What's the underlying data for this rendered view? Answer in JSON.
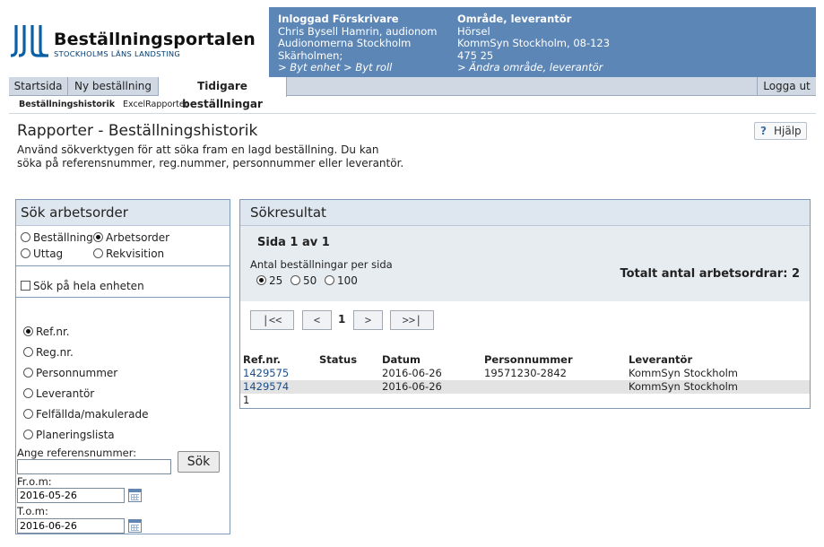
{
  "brand": {
    "title": "Beställningsportalen",
    "subtitle": "STOCKHOLMS LÄNS LANDSTING",
    "color": "#0b5fa5"
  },
  "userbox": {
    "col1": {
      "heading": "Inloggad Förskrivare",
      "lines": [
        "Chris Bysell Hamrin, audionom",
        "Audionomerna Stockholm",
        "Skärholmen;"
      ],
      "link1": "> Byt enhet",
      "link2": "> Byt roll"
    },
    "col2": {
      "heading": "Område, leverantör",
      "lines": [
        "Hörsel",
        "KommSyn Stockholm, 08-123",
        "475 25"
      ],
      "link": "> Ändra område, leverantör"
    },
    "color": "#5b86b6"
  },
  "tabs": [
    {
      "label": "Startsida",
      "active": false
    },
    {
      "label": "Ny beställning",
      "active": false
    },
    {
      "label": "Tidigare beställningar",
      "active": true
    }
  ],
  "logout": "Logga ut",
  "subnav": {
    "items": [
      {
        "label": "Beställningshistorik",
        "active": true
      },
      {
        "label": "ExcelRapporter",
        "active": false
      }
    ]
  },
  "page": {
    "title": "Rapporter - Beställningshistorik",
    "intro_line1": "Använd sökverktygen för att söka fram en lagd beställning. Du kan",
    "intro_line2": "söka på referensnummer, reg.nummer, personnummer eller leverantör.",
    "help_icon": "question-icon",
    "help": "Hjälp"
  },
  "search": {
    "title": "Sök arbetsorder",
    "types": [
      {
        "label": "Beställning",
        "checked": false
      },
      {
        "label": "Arbetsorder",
        "checked": true
      },
      {
        "label": "Uttag",
        "checked": false
      },
      {
        "label": "Rekvisition",
        "checked": false
      }
    ],
    "whole_unit": {
      "label": "Sök på hela enheten",
      "checked": false
    },
    "criteria": [
      {
        "label": "Ref.nr.",
        "checked": true
      },
      {
        "label": "Reg.nr.",
        "checked": false
      },
      {
        "label": "Personnummer",
        "checked": false
      },
      {
        "label": "Leverantör",
        "checked": false
      },
      {
        "label": "Felfällda/makulerade",
        "checked": false
      },
      {
        "label": "Planeringslista",
        "checked": false
      }
    ],
    "ref_label": "Ange referensnummer:",
    "ref_value": "",
    "button": "Sök",
    "from_label": "Fr.o.m:",
    "from_value": "2016-05-26",
    "to_label": "T.o.m:",
    "to_value": "2016-06-26",
    "calendar_icon": "calendar-icon"
  },
  "results": {
    "title": "Sökresultat",
    "page_info": "Sida 1 av 1",
    "per_page_label": "Antal beställningar per sida",
    "per_page_options": [
      {
        "label": "25",
        "checked": true
      },
      {
        "label": "50",
        "checked": false
      },
      {
        "label": "100",
        "checked": false
      }
    ],
    "total": "Totalt antal arbetsordrar: 2",
    "pager": {
      "first": "|<<",
      "prev": "<",
      "current": "1",
      "next": ">",
      "last": ">>|"
    },
    "columns": [
      "Ref.nr.",
      "Status",
      "Datum",
      "Personnummer",
      "Leverantör"
    ],
    "rows": [
      {
        "ref": "1429575",
        "status": "",
        "date": "2016-06-26",
        "pnr": "19571230-2842",
        "supplier": "KommSyn Stockholm"
      },
      {
        "ref": "1429574",
        "status": "",
        "date": "2016-06-26",
        "pnr": "",
        "supplier": "KommSyn Stockholm"
      }
    ],
    "footer_page": "1"
  }
}
